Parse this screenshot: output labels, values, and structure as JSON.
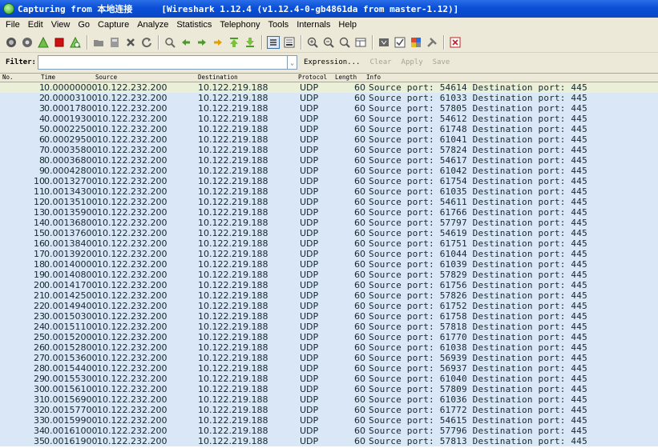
{
  "window": {
    "title_left": "Capturing from 本地连接",
    "title_right": "[Wireshark 1.12.4  (v1.12.4-0-gb4861da from master-1.12)]"
  },
  "menu": [
    "File",
    "Edit",
    "View",
    "Go",
    "Capture",
    "Analyze",
    "Statistics",
    "Telephony",
    "Tools",
    "Internals",
    "Help"
  ],
  "filter": {
    "label": "Filter:",
    "value": "",
    "expression_label": "Expression...",
    "clear_label": "Clear",
    "apply_label": "Apply",
    "save_label": "Save"
  },
  "columns": {
    "no": "No.",
    "time": "Time",
    "source": "Source",
    "destination": "Destination",
    "protocol": "Protocol",
    "length": "Length",
    "info": "Info"
  },
  "packets": [
    {
      "no": "1",
      "time": "0.00000000",
      "src": "10.122.232.200",
      "dst": "10.122.219.188",
      "proto": "UDP",
      "len": "60",
      "info": "Source port: 54614  Destination port: 445"
    },
    {
      "no": "2",
      "time": "0.00003100",
      "src": "10.122.232.200",
      "dst": "10.122.219.188",
      "proto": "UDP",
      "len": "60",
      "info": "Source port: 61033  Destination port: 445"
    },
    {
      "no": "3",
      "time": "0.00017800",
      "src": "10.122.232.200",
      "dst": "10.122.219.188",
      "proto": "UDP",
      "len": "60",
      "info": "Source port: 57805  Destination port: 445"
    },
    {
      "no": "4",
      "time": "0.00019300",
      "src": "10.122.232.200",
      "dst": "10.122.219.188",
      "proto": "UDP",
      "len": "60",
      "info": "Source port: 54612  Destination port: 445"
    },
    {
      "no": "5",
      "time": "0.00022500",
      "src": "10.122.232.200",
      "dst": "10.122.219.188",
      "proto": "UDP",
      "len": "60",
      "info": "Source port: 61748  Destination port: 445"
    },
    {
      "no": "6",
      "time": "0.00029500",
      "src": "10.122.232.200",
      "dst": "10.122.219.188",
      "proto": "UDP",
      "len": "60",
      "info": "Source port: 61041  Destination port: 445"
    },
    {
      "no": "7",
      "time": "0.00035800",
      "src": "10.122.232.200",
      "dst": "10.122.219.188",
      "proto": "UDP",
      "len": "60",
      "info": "Source port: 57824  Destination port: 445"
    },
    {
      "no": "8",
      "time": "0.00036800",
      "src": "10.122.232.200",
      "dst": "10.122.219.188",
      "proto": "UDP",
      "len": "60",
      "info": "Source port: 54617  Destination port: 445"
    },
    {
      "no": "9",
      "time": "0.00042800",
      "src": "10.122.232.200",
      "dst": "10.122.219.188",
      "proto": "UDP",
      "len": "60",
      "info": "Source port: 61042  Destination port: 445"
    },
    {
      "no": "10",
      "time": "0.00132700",
      "src": "10.122.232.200",
      "dst": "10.122.219.188",
      "proto": "UDP",
      "len": "60",
      "info": "Source port: 61754  Destination port: 445"
    },
    {
      "no": "11",
      "time": "0.00134300",
      "src": "10.122.232.200",
      "dst": "10.122.219.188",
      "proto": "UDP",
      "len": "60",
      "info": "Source port: 61035  Destination port: 445"
    },
    {
      "no": "12",
      "time": "0.00135100",
      "src": "10.122.232.200",
      "dst": "10.122.219.188",
      "proto": "UDP",
      "len": "60",
      "info": "Source port: 54611  Destination port: 445"
    },
    {
      "no": "13",
      "time": "0.00135900",
      "src": "10.122.232.200",
      "dst": "10.122.219.188",
      "proto": "UDP",
      "len": "60",
      "info": "Source port: 61766  Destination port: 445"
    },
    {
      "no": "14",
      "time": "0.00136800",
      "src": "10.122.232.200",
      "dst": "10.122.219.188",
      "proto": "UDP",
      "len": "60",
      "info": "Source port: 57797  Destination port: 445"
    },
    {
      "no": "15",
      "time": "0.00137600",
      "src": "10.122.232.200",
      "dst": "10.122.219.188",
      "proto": "UDP",
      "len": "60",
      "info": "Source port: 54619  Destination port: 445"
    },
    {
      "no": "16",
      "time": "0.00138400",
      "src": "10.122.232.200",
      "dst": "10.122.219.188",
      "proto": "UDP",
      "len": "60",
      "info": "Source port: 61751  Destination port: 445"
    },
    {
      "no": "17",
      "time": "0.00139200",
      "src": "10.122.232.200",
      "dst": "10.122.219.188",
      "proto": "UDP",
      "len": "60",
      "info": "Source port: 61044  Destination port: 445"
    },
    {
      "no": "18",
      "time": "0.00140000",
      "src": "10.122.232.200",
      "dst": "10.122.219.188",
      "proto": "UDP",
      "len": "60",
      "info": "Source port: 61039  Destination port: 445"
    },
    {
      "no": "19",
      "time": "0.00140800",
      "src": "10.122.232.200",
      "dst": "10.122.219.188",
      "proto": "UDP",
      "len": "60",
      "info": "Source port: 57829  Destination port: 445"
    },
    {
      "no": "20",
      "time": "0.00141700",
      "src": "10.122.232.200",
      "dst": "10.122.219.188",
      "proto": "UDP",
      "len": "60",
      "info": "Source port: 61756  Destination port: 445"
    },
    {
      "no": "21",
      "time": "0.00142500",
      "src": "10.122.232.200",
      "dst": "10.122.219.188",
      "proto": "UDP",
      "len": "60",
      "info": "Source port: 57826  Destination port: 445"
    },
    {
      "no": "22",
      "time": "0.00149400",
      "src": "10.122.232.200",
      "dst": "10.122.219.188",
      "proto": "UDP",
      "len": "60",
      "info": "Source port: 61752  Destination port: 445"
    },
    {
      "no": "23",
      "time": "0.00150300",
      "src": "10.122.232.200",
      "dst": "10.122.219.188",
      "proto": "UDP",
      "len": "60",
      "info": "Source port: 61758  Destination port: 445"
    },
    {
      "no": "24",
      "time": "0.00151100",
      "src": "10.122.232.200",
      "dst": "10.122.219.188",
      "proto": "UDP",
      "len": "60",
      "info": "Source port: 57818  Destination port: 445"
    },
    {
      "no": "25",
      "time": "0.00152000",
      "src": "10.122.232.200",
      "dst": "10.122.219.188",
      "proto": "UDP",
      "len": "60",
      "info": "Source port: 61770  Destination port: 445"
    },
    {
      "no": "26",
      "time": "0.00152800",
      "src": "10.122.232.200",
      "dst": "10.122.219.188",
      "proto": "UDP",
      "len": "60",
      "info": "Source port: 61038  Destination port: 445"
    },
    {
      "no": "27",
      "time": "0.00153600",
      "src": "10.122.232.200",
      "dst": "10.122.219.188",
      "proto": "UDP",
      "len": "60",
      "info": "Source port: 56939  Destination port: 445"
    },
    {
      "no": "28",
      "time": "0.00154400",
      "src": "10.122.232.200",
      "dst": "10.122.219.188",
      "proto": "UDP",
      "len": "60",
      "info": "Source port: 56937  Destination port: 445"
    },
    {
      "no": "29",
      "time": "0.00155300",
      "src": "10.122.232.200",
      "dst": "10.122.219.188",
      "proto": "UDP",
      "len": "60",
      "info": "Source port: 61040  Destination port: 445"
    },
    {
      "no": "30",
      "time": "0.00156100",
      "src": "10.122.232.200",
      "dst": "10.122.219.188",
      "proto": "UDP",
      "len": "60",
      "info": "Source port: 57809  Destination port: 445"
    },
    {
      "no": "31",
      "time": "0.00156900",
      "src": "10.122.232.200",
      "dst": "10.122.219.188",
      "proto": "UDP",
      "len": "60",
      "info": "Source port: 61036  Destination port: 445"
    },
    {
      "no": "32",
      "time": "0.00157700",
      "src": "10.122.232.200",
      "dst": "10.122.219.188",
      "proto": "UDP",
      "len": "60",
      "info": "Source port: 61772  Destination port: 445"
    },
    {
      "no": "33",
      "time": "0.00159900",
      "src": "10.122.232.200",
      "dst": "10.122.219.188",
      "proto": "UDP",
      "len": "60",
      "info": "Source port: 54615  Destination port: 445"
    },
    {
      "no": "34",
      "time": "0.00161000",
      "src": "10.122.232.200",
      "dst": "10.122.219.188",
      "proto": "UDP",
      "len": "60",
      "info": "Source port: 57796  Destination port: 445"
    },
    {
      "no": "35",
      "time": "0.00161900",
      "src": "10.122.232.200",
      "dst": "10.122.219.188",
      "proto": "UDP",
      "len": "60",
      "info": "Source port: 57813  Destination port: 445"
    }
  ],
  "toolbar_icons": [
    "interfaces-icon",
    "options-icon",
    "start-capture-icon",
    "stop-capture-icon",
    "restart-capture-icon",
    "open-file-icon",
    "save-file-icon",
    "close-file-icon",
    "reload-icon",
    "find-icon",
    "back-icon",
    "forward-icon",
    "go-to-packet-icon",
    "first-packet-icon",
    "last-packet-icon",
    "colorize-icon",
    "autoscroll-icon",
    "zoom-in-icon",
    "zoom-out-icon",
    "normal-size-icon",
    "resize-columns-icon",
    "capture-filters-icon",
    "display-filters-icon",
    "coloring-rules-icon",
    "preferences-icon",
    "help-icon"
  ],
  "colors": {
    "row_bg": "#dae7f6",
    "row_selected_bg": "#eaf0d8",
    "title_bar": "#0a4fd6"
  }
}
